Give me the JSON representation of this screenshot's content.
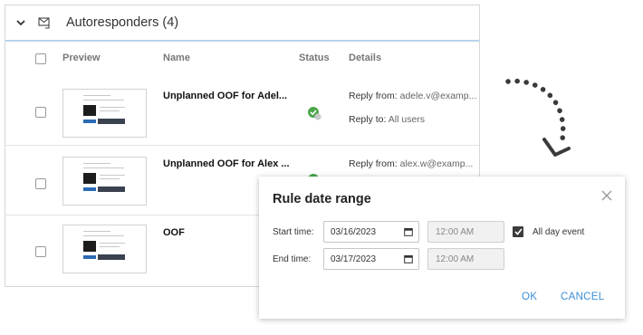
{
  "section": {
    "title": "Autoresponders (4)",
    "icons": {
      "collapse": "chevron-down-icon",
      "section": "mail-reply-icon"
    }
  },
  "columns": {
    "preview": "Preview",
    "name": "Name",
    "status": "Status",
    "details": "Details"
  },
  "rows": [
    {
      "name": "Unplanned OOF for Adel...",
      "status": "enabled",
      "reply_from_label": "Reply from:",
      "reply_from_value": "adele.v@examp...",
      "reply_to_label": "Reply to:",
      "reply_to_value": "All users"
    },
    {
      "name": "Unplanned OOF for Alex ...",
      "status": "enabled",
      "reply_from_label": "Reply from:",
      "reply_from_value": "alex.w@examp..."
    },
    {
      "name": "OOF"
    }
  ],
  "dialog": {
    "title": "Rule date range",
    "start_label": "Start time:",
    "start_date": "03/16/2023",
    "start_time": "12:00 AM",
    "end_label": "End time:",
    "end_date": "03/17/2023",
    "end_time": "12:00 AM",
    "all_day_label": "All day event",
    "all_day_checked": true,
    "ok_label": "OK",
    "cancel_label": "CANCEL"
  },
  "colors": {
    "accent_blue": "#3b8fd6",
    "status_green": "#4aa64a",
    "header_rule": "#b9d4ea"
  }
}
